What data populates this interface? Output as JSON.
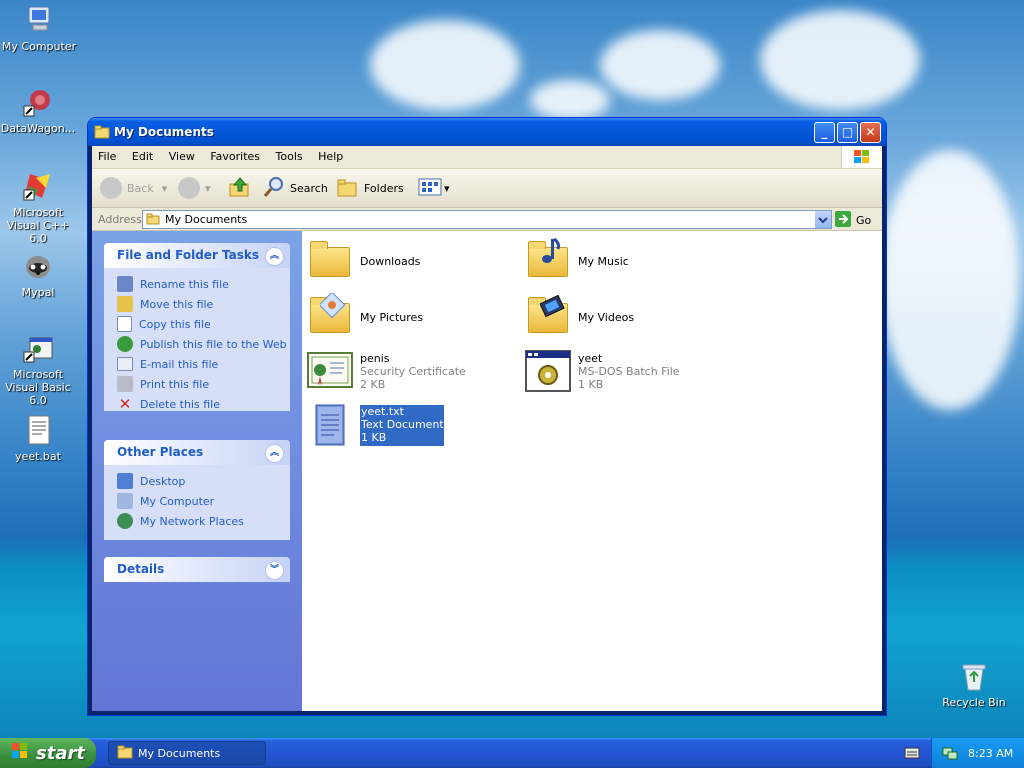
{
  "desktop": {
    "icons": [
      {
        "label": "My Computer",
        "icon": "my-computer-icon"
      },
      {
        "label": "DataWagon...",
        "icon": "datawagon-shortcut-icon"
      },
      {
        "label": "Microsoft Visual C++ 6.0",
        "icon": "visual-cpp-shortcut-icon"
      },
      {
        "label": "Mypal",
        "icon": "mypal-icon"
      },
      {
        "label": "Microsoft Visual Basic 6.0",
        "icon": "visual-basic-shortcut-icon"
      },
      {
        "label": "yeet.bat",
        "icon": "batch-file-icon"
      },
      {
        "label": "Recycle Bin",
        "icon": "recycle-bin-icon"
      }
    ]
  },
  "window": {
    "title": "My Documents",
    "menu": [
      "File",
      "Edit",
      "View",
      "Favorites",
      "Tools",
      "Help"
    ],
    "toolbar": {
      "back_label": "Back",
      "search_label": "Search",
      "folders_label": "Folders"
    },
    "address": {
      "label": "Address",
      "value": "My Documents",
      "go_label": "Go"
    },
    "tasks_panel": {
      "title": "File and Folder Tasks",
      "items": [
        {
          "label": "Rename this file",
          "icon": "rename-icon"
        },
        {
          "label": "Move this file",
          "icon": "move-icon"
        },
        {
          "label": "Copy this file",
          "icon": "copy-icon"
        },
        {
          "label": "Publish this file to the Web",
          "icon": "publish-web-icon"
        },
        {
          "label": "E-mail this file",
          "icon": "email-icon"
        },
        {
          "label": "Print this file",
          "icon": "print-icon"
        },
        {
          "label": "Delete this file",
          "icon": "delete-icon"
        }
      ]
    },
    "places_panel": {
      "title": "Other Places",
      "items": [
        {
          "label": "Desktop",
          "icon": "desktop-icon"
        },
        {
          "label": "My Computer",
          "icon": "my-computer-icon"
        },
        {
          "label": "My Network Places",
          "icon": "network-places-icon"
        }
      ]
    },
    "details_panel": {
      "title": "Details"
    },
    "files": [
      {
        "name": "Downloads",
        "type": "",
        "size": "",
        "icon": "folder-icon"
      },
      {
        "name": "My Music",
        "type": "",
        "size": "",
        "icon": "music-folder-icon"
      },
      {
        "name": "My Pictures",
        "type": "",
        "size": "",
        "icon": "pictures-folder-icon"
      },
      {
        "name": "My Videos",
        "type": "",
        "size": "",
        "icon": "videos-folder-icon"
      },
      {
        "name": "penis",
        "type": "Security Certificate",
        "size": "2 KB",
        "icon": "certificate-icon"
      },
      {
        "name": "yeet",
        "type": "MS-DOS Batch File",
        "size": "1 KB",
        "icon": "batch-file-icon"
      },
      {
        "name": "yeet.txt",
        "type": "Text Document",
        "size": "1 KB",
        "icon": "text-document-icon",
        "selected": true
      }
    ]
  },
  "taskbar": {
    "start_label": "start",
    "task_label": "My Documents",
    "clock": "8:23 AM"
  },
  "colors": {
    "title_blue": "#0458d8",
    "selection": "#316ac5",
    "task_link": "#215dc6",
    "start_green": "#388e3c"
  }
}
